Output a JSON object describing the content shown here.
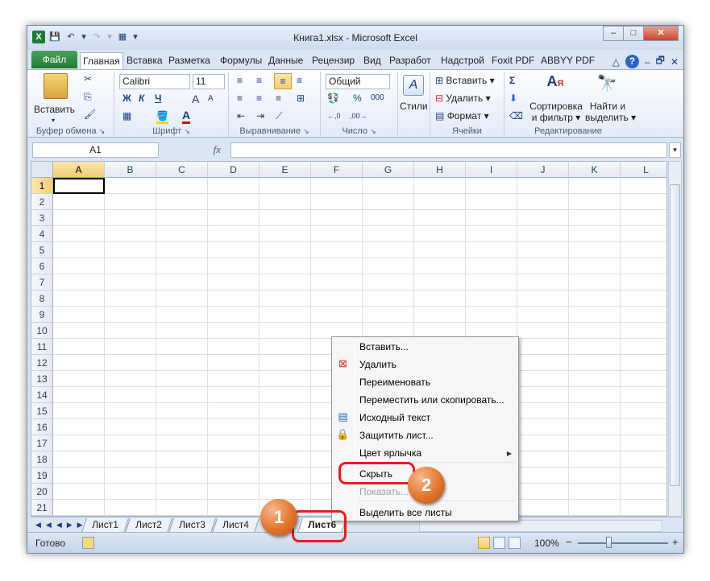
{
  "window": {
    "title": "Книга1.xlsx - Microsoft Excel",
    "min": "–",
    "max": "□",
    "close": "✕"
  },
  "qat": {
    "excel_icon": "X",
    "save": "💾",
    "undo": "↶",
    "undo_arrow": "▾",
    "redo": "↷",
    "redo_arrow": "▾",
    "print": "▦",
    "customize": "▾"
  },
  "ribbon_tabs": [
    "Файл",
    "Главная",
    "Вставка",
    "Разметка",
    "Формулы",
    "Данные",
    "Рецензир",
    "Вид",
    "Разработ",
    "Надстрой",
    "Foxit PDF",
    "ABBYY PDF"
  ],
  "ribbon_icons": {
    "minimize": "△",
    "help": "?",
    "doc_min": "–",
    "doc_restore": "🗗",
    "doc_close": "✕"
  },
  "clipboard": {
    "paste": "Вставить",
    "cut": "✂",
    "copy": "⎘",
    "format_painter": "🖌",
    "label": "Буфер обмена",
    "launcher": "↘"
  },
  "font": {
    "name": "Calibri",
    "size": "11",
    "bold": "Ж",
    "italic": "К",
    "underline": "Ч",
    "grow": "A",
    "shrink": "A",
    "borders": "▦",
    "fill": "🪣",
    "color": "A",
    "label": "Шрифт",
    "launcher": "↘"
  },
  "alignment": {
    "label": "Выравнивание",
    "wrap": "≡",
    "merge": "⊞",
    "launcher": "↘"
  },
  "number": {
    "format": "Общий",
    "percent": "%",
    "thousands": "000",
    "inc_dec": "←,0",
    "dec_dec": ",00→",
    "currency": "💱",
    "label": "Число",
    "launcher": "↘"
  },
  "styles": {
    "label": "Стили",
    "icon": "A"
  },
  "cells": {
    "insert": "Вставить",
    "delete": "Удалить",
    "format": "Формат",
    "label": "Ячейки"
  },
  "editing": {
    "sum": "Σ",
    "fill": "⬇",
    "clear": "⌫",
    "sort1": "Сортировка",
    "sort2": "и фильтр",
    "find1": "Найти и",
    "find2": "выделить",
    "label": "Редактирование"
  },
  "formula_bar": {
    "name_box": "A1",
    "fx": "fx",
    "value": ""
  },
  "columns": [
    "A",
    "B",
    "C",
    "D",
    "E",
    "F",
    "G",
    "H",
    "I",
    "J",
    "K",
    "L"
  ],
  "rows": [
    "1",
    "2",
    "3",
    "4",
    "5",
    "6",
    "7",
    "8",
    "9",
    "10",
    "11",
    "12",
    "13",
    "14",
    "15",
    "16",
    "17",
    "18",
    "19",
    "20",
    "21"
  ],
  "sheet_tabs": [
    "Лист1",
    "Лист2",
    "Лист3",
    "Лист4",
    "Лист6"
  ],
  "active_sheet": "Лист6",
  "context_menu": {
    "insert": "Вставить...",
    "delete": "Удалить",
    "rename": "Переименовать",
    "move_copy": "Переместить или скопировать...",
    "view_code": "Исходный текст",
    "protect": "Защитить лист...",
    "tab_color": "Цвет ярлычка",
    "hide": "Скрыть",
    "unhide": "Показать...",
    "select_all": "Выделить все листы"
  },
  "status": {
    "ready": "Готово",
    "zoom": "100%",
    "zoom_minus": "−",
    "zoom_plus": "+"
  },
  "annotations": {
    "step1": "1",
    "step2": "2"
  },
  "colors": {
    "highlight": "#e41e1e",
    "badge": "#e0752c",
    "file_tab": "#217a35"
  }
}
